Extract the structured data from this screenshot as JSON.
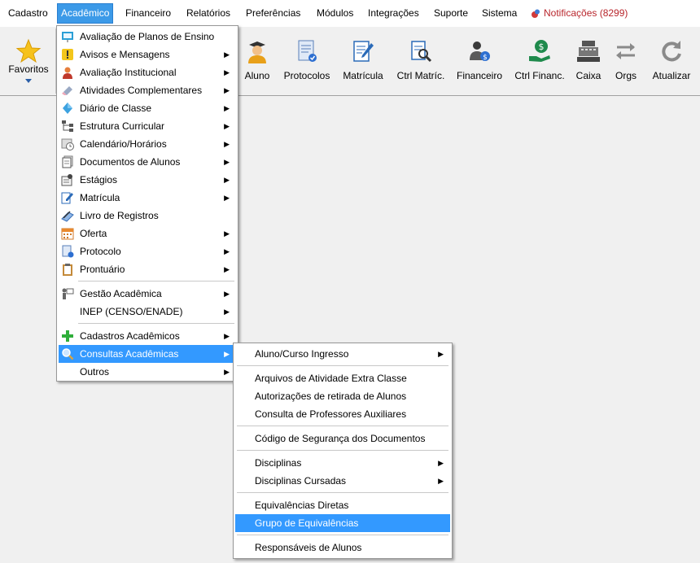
{
  "menubar": {
    "items": [
      "Cadastro",
      "Acadêmico",
      "Financeiro",
      "Relatórios",
      "Preferências",
      "Módulos",
      "Integrações",
      "Suporte",
      "Sistema"
    ],
    "notifications": "Notificações (8299)"
  },
  "toolbar": {
    "favoritos": "Favoritos",
    "aluno": "Aluno",
    "protocolos": "Protocolos",
    "matricula": "Matrícula",
    "ctrl_matric": "Ctrl Matríc.",
    "financeiro": "Financeiro",
    "ctrl_financ": "Ctrl Financ.",
    "caixa": "Caixa",
    "orgs": "Orgs",
    "atualizar": "Atualizar"
  },
  "academico_menu": {
    "items": [
      {
        "label": "Avaliação de Planos de Ensino",
        "icon": "presentation-board-icon"
      },
      {
        "label": "Avisos e Mensagens",
        "icon": "warning-icon"
      },
      {
        "label": "Avaliação Institucional",
        "icon": "person-icon"
      },
      {
        "label": "Atividades Complementares",
        "icon": "eraser-icon"
      },
      {
        "label": "Diário de Classe",
        "icon": "diamond-icon"
      },
      {
        "label": "Estrutura Curricular",
        "icon": "org-chart-icon"
      },
      {
        "label": "Calendário/Horários",
        "icon": "calendar-clock-icon"
      },
      {
        "label": "Documentos de Alunos",
        "icon": "documents-icon"
      },
      {
        "label": "Estágios",
        "icon": "internship-icon"
      },
      {
        "label": "Matrícula",
        "icon": "edit-form-icon"
      },
      {
        "label": "Livro de Registros",
        "icon": "book-pen-icon"
      },
      {
        "label": "Oferta",
        "icon": "calendar-icon"
      },
      {
        "label": "Protocolo",
        "icon": "protocol-icon"
      },
      {
        "label": "Prontuário",
        "icon": "clipboard-icon"
      },
      {
        "label": "Gestão Acadêmica",
        "icon": "teacher-icon"
      },
      {
        "label": "INEP (CENSO/ENADE)",
        "icon": ""
      },
      {
        "label": "Cadastros Acadêmicos",
        "icon": "green-plus-icon"
      },
      {
        "label": "Consultas Acadêmicas",
        "icon": "magnifier-icon"
      },
      {
        "label": "Outros",
        "icon": ""
      }
    ]
  },
  "consultas_menu": {
    "items": [
      "Aluno/Curso Ingresso",
      "Arquivos de Atividade Extra Classe",
      "Autorizações de retirada de Alunos",
      "Consulta de Professores Auxiliares",
      "Código de Segurança dos Documentos",
      "Disciplinas",
      "Disciplinas Cursadas",
      "Equivalências Diretas",
      "Grupo de Equivalências",
      "Responsáveis de Alunos"
    ]
  },
  "colors": {
    "highlight": "#3399ff",
    "menubar_active": "#3c9ae8",
    "notification": "#b8262c"
  }
}
